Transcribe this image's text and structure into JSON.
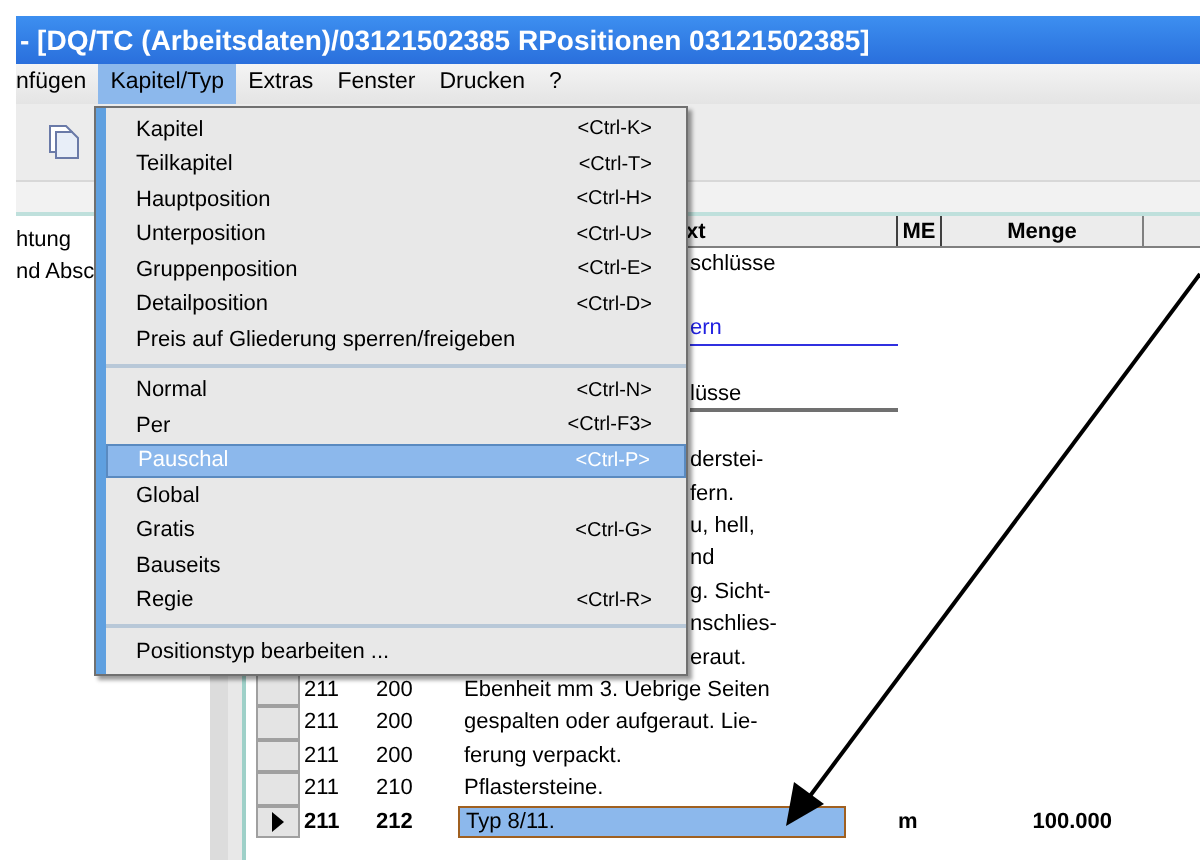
{
  "window": {
    "title": "- [DQ/TC (Arbeitsdaten)/03121502385 RPositionen 03121502385]"
  },
  "menu_bar": [
    {
      "label": "nfügen",
      "selected": false
    },
    {
      "label": "Kapitel/Typ",
      "selected": true
    },
    {
      "label": "Extras",
      "selected": false
    },
    {
      "label": "Fenster",
      "selected": false
    },
    {
      "label": "Drucken",
      "selected": false
    },
    {
      "label": "?",
      "selected": false
    }
  ],
  "left_panel": {
    "lines": [
      "htung",
      "nd Absc"
    ]
  },
  "table": {
    "columns": [
      "xt",
      "ME",
      "Menge"
    ],
    "rows": [
      {
        "kind": "covered",
        "text": "schlüsse"
      },
      {
        "kind": "empty"
      },
      {
        "kind": "covered-link",
        "text": "ern"
      },
      {
        "kind": "empty"
      },
      {
        "kind": "covered-field",
        "text": "lüsse"
      },
      {
        "kind": "empty"
      },
      {
        "kind": "covered",
        "text": "derstei-"
      },
      {
        "kind": "covered",
        "text": "fern."
      },
      {
        "kind": "covered",
        "text": "u, hell,"
      },
      {
        "kind": "covered",
        "text": "nd"
      },
      {
        "kind": "covered",
        "text": "g. Sicht-"
      },
      {
        "kind": "covered",
        "text": "nschlies-"
      },
      {
        "kind": "covered",
        "text": "eraut."
      },
      {
        "kind": "full",
        "col1": "211",
        "col2": "200",
        "text": "Ebenheit mm 3. Uebrige Seiten",
        "selected": false
      },
      {
        "kind": "full",
        "col1": "211",
        "col2": "200",
        "text": "gespalten oder aufgeraut. Lie-",
        "selected": false
      },
      {
        "kind": "full",
        "col1": "211",
        "col2": "200",
        "text": "ferung verpackt.",
        "selected": false
      },
      {
        "kind": "full",
        "col1": "211",
        "col2": "210",
        "text": "Pflastersteine.",
        "selected": false
      },
      {
        "kind": "full",
        "col1": "211",
        "col2": "212",
        "text": "Typ 8/11.",
        "me": "m",
        "menge": "100.000",
        "selected": true
      }
    ]
  },
  "menu": {
    "items": [
      {
        "kind": "item",
        "label": "Kapitel",
        "shortcut": "<Ctrl-K>",
        "selected": false
      },
      {
        "kind": "item",
        "label": "Teilkapitel",
        "shortcut": "<Ctrl-T>",
        "selected": false
      },
      {
        "kind": "item",
        "label": "Hauptposition",
        "shortcut": "<Ctrl-H>",
        "selected": false
      },
      {
        "kind": "item",
        "label": "Unterposition",
        "shortcut": "<Ctrl-U>",
        "selected": false
      },
      {
        "kind": "item",
        "label": "Gruppenposition",
        "shortcut": "<Ctrl-E>",
        "selected": false
      },
      {
        "kind": "item",
        "label": "Detailposition",
        "shortcut": "<Ctrl-D>",
        "selected": false
      },
      {
        "kind": "item",
        "label": "Preis auf Gliederung sperren/freigeben",
        "selected": false
      },
      {
        "kind": "separator"
      },
      {
        "kind": "item",
        "label": "Normal",
        "shortcut": "<Ctrl-N>",
        "selected": false
      },
      {
        "kind": "item",
        "label": "Per",
        "shortcut": "<Ctrl-F3>",
        "selected": false
      },
      {
        "kind": "item",
        "label": "Pauschal",
        "shortcut": "<Ctrl-P>",
        "selected": true
      },
      {
        "kind": "item",
        "label": "Global",
        "selected": false
      },
      {
        "kind": "item",
        "label": "Gratis",
        "shortcut": "<Ctrl-G>",
        "selected": false
      },
      {
        "kind": "item",
        "label": "Bauseits",
        "selected": false
      },
      {
        "kind": "item",
        "label": "Regie",
        "shortcut": "<Ctrl-R>",
        "selected": false
      },
      {
        "kind": "separator"
      },
      {
        "kind": "item",
        "label": "Positionstyp bearbeiten ...",
        "selected": false
      }
    ]
  }
}
